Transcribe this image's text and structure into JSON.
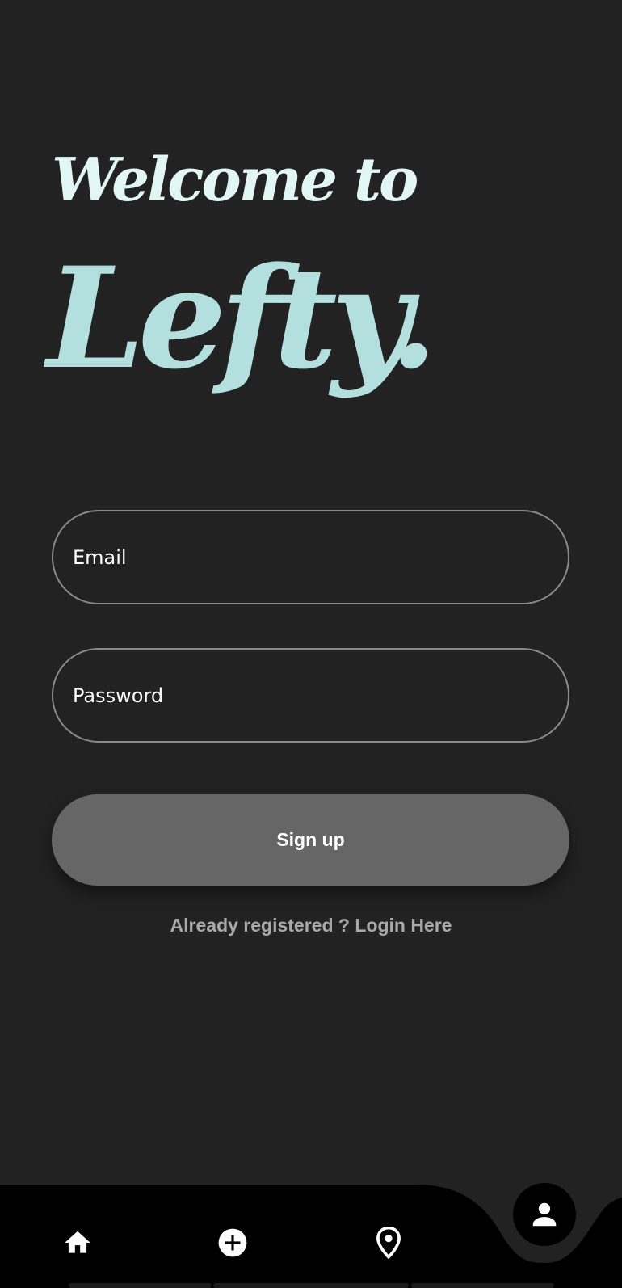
{
  "welcome": {
    "line1": "Welcome to",
    "brand": "Lefty."
  },
  "form": {
    "email_placeholder": "Email",
    "password_placeholder": "Password",
    "signup_label": "Sign up",
    "login_link": "Already registered ? Login Here"
  },
  "nav": {
    "items": [
      {
        "icon": "home-icon"
      },
      {
        "icon": "add-circle-icon"
      },
      {
        "icon": "location-pin-icon"
      },
      {
        "icon": "profile-icon",
        "active": true
      }
    ]
  },
  "colors": {
    "background": "#222222",
    "welcome_text": "#e3f6f6",
    "brand_text": "#b4dfdf",
    "field_border": "#8a8a8a",
    "button": "#666666",
    "link": "#a9a9a9",
    "navbar": "#000000"
  }
}
